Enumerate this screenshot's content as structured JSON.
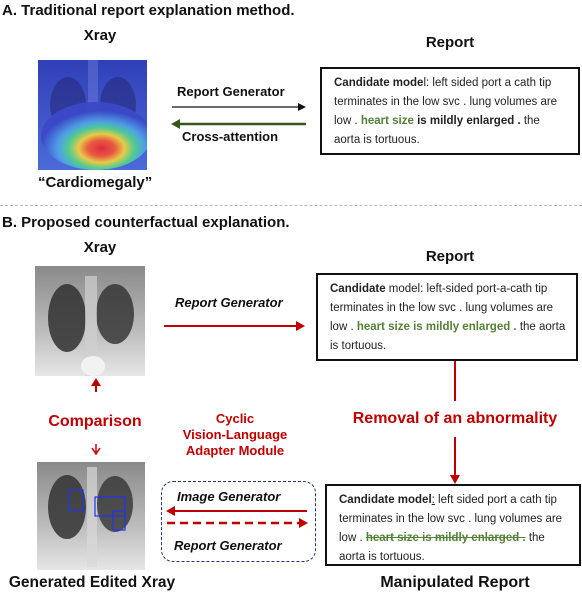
{
  "section_a": {
    "title": "A. Traditional report explanation method.",
    "xray_label": "Xray",
    "prediction_label": "“Cardiomegaly”",
    "report_label": "Report",
    "arrow_forward_label": "Report Generator",
    "arrow_back_label": "Cross-attention",
    "report": {
      "prefix_bold": "Candidate mode",
      "prefix_rest": "l: left sided port a cath tip terminates in the low svc . lung volumes are low . ",
      "highlight": "heart size",
      "highlight_tail": " is mildly enlarged .",
      "suffix": " the aorta is tortuous."
    }
  },
  "section_b": {
    "title": "B. Proposed counterfactual explanation.",
    "xray_label": "Xray",
    "report_label": "Report",
    "arrow_forward_label": "Report Generator",
    "comparison_label": "Comparison",
    "adapter_label_1": "Cyclic",
    "adapter_label_2": "Vision-Language",
    "adapter_label_3": "Adapter Module",
    "removal_label": "Removal of an abnormality",
    "image_generator_label": "Image Generator",
    "report_generator_label": "Report Generator",
    "edited_xray_label": "Generated Edited Xray",
    "manipulated_report_label": "Manipulated Report",
    "report": {
      "prefix_bold": "Candidate",
      "prefix_rest": " model",
      "colon": ":  left-sided port-a-cath tip terminates in the low svc . lung volumes are low . ",
      "highlight": "heart size is mildly enlarged .",
      "suffix": " the aorta is tortuous."
    },
    "manipulated_report": {
      "prefix_bold": "Candidate model",
      "colon": ":",
      "text": " left sided port a cath tip terminates in the low svc . lung volumes are low . ",
      "removed": "heart size is mildly enlarged .",
      "suffix": " the aorta is tortuous."
    }
  },
  "colors": {
    "accent_red": "#c00000",
    "accent_green": "#538135",
    "adapter_border": "#1f3864",
    "box_blue": "#2233ee"
  }
}
